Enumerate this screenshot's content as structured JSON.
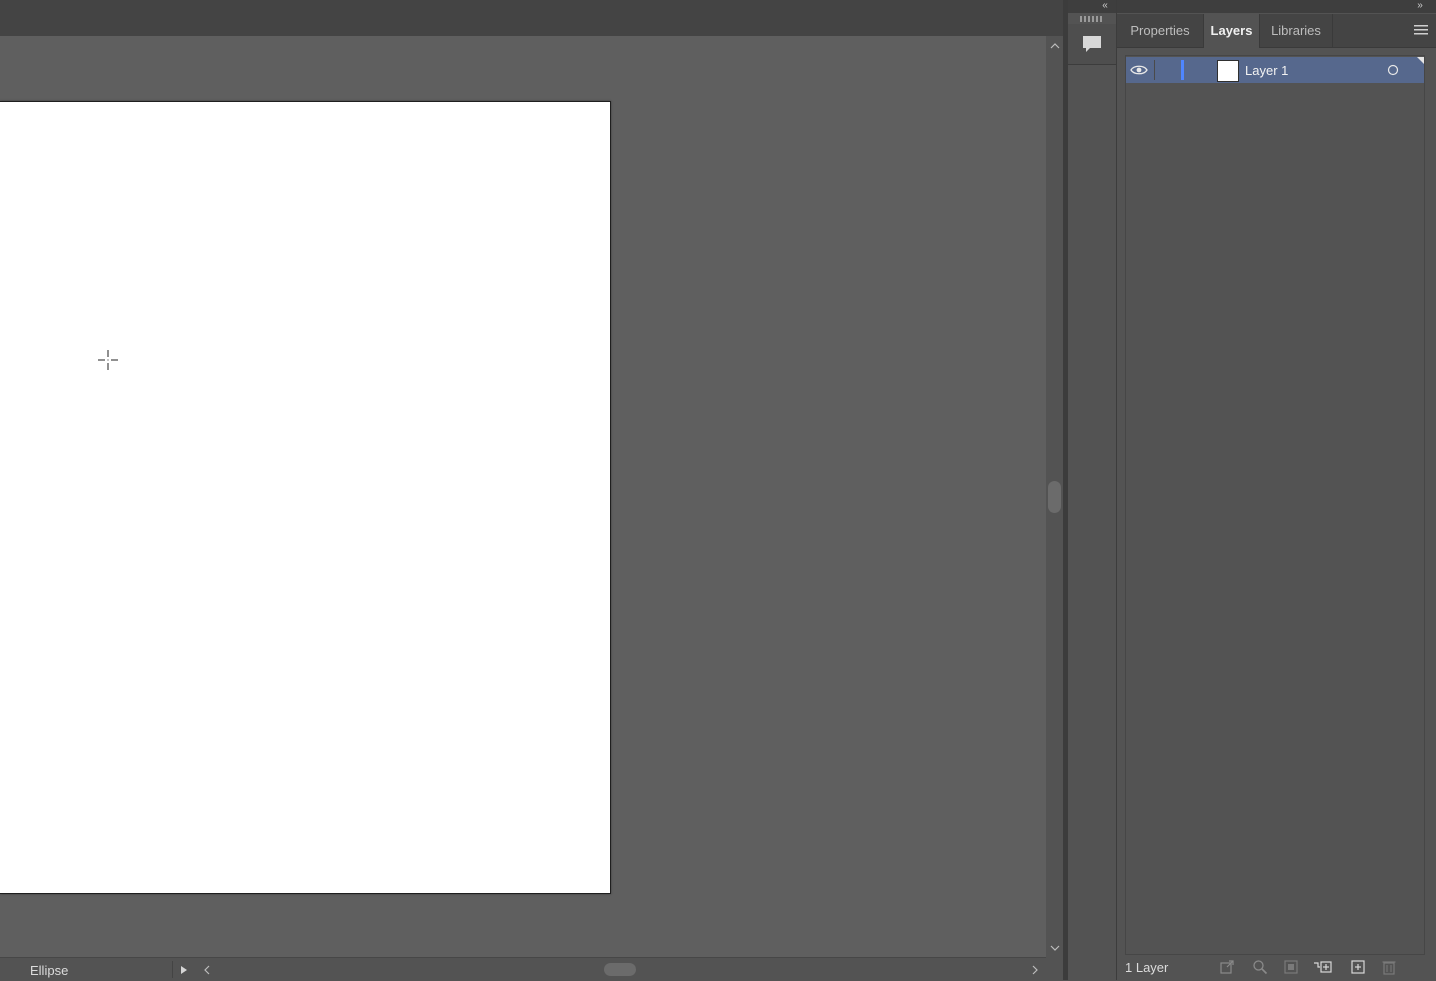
{
  "tabs": [
    {
      "label": "Properties",
      "active": false
    },
    {
      "label": "Layers",
      "active": true
    },
    {
      "label": "Libraries",
      "active": false
    }
  ],
  "layers": [
    {
      "name": "Layer 1",
      "visible": true,
      "color": "#4f86ff",
      "thumbnail_color": "#ffffff"
    }
  ],
  "footer": {
    "layer_count": "1 Layer",
    "buttons": [
      "export-icon",
      "locate-object-icon",
      "make-clipping-mask-icon",
      "create-sublayer-icon",
      "new-layer-icon",
      "delete-icon"
    ]
  },
  "status": {
    "tool_label": "Ellipse"
  },
  "dock": {
    "collapse_glyph": "«",
    "expand_glyph": "»",
    "comments_icon": "comment-icon"
  },
  "colors": {
    "canvas_bg": "#5f5f5f",
    "artboard": "#ffffff",
    "selected_row": "#56688d",
    "layer_color": "#4f86ff"
  }
}
